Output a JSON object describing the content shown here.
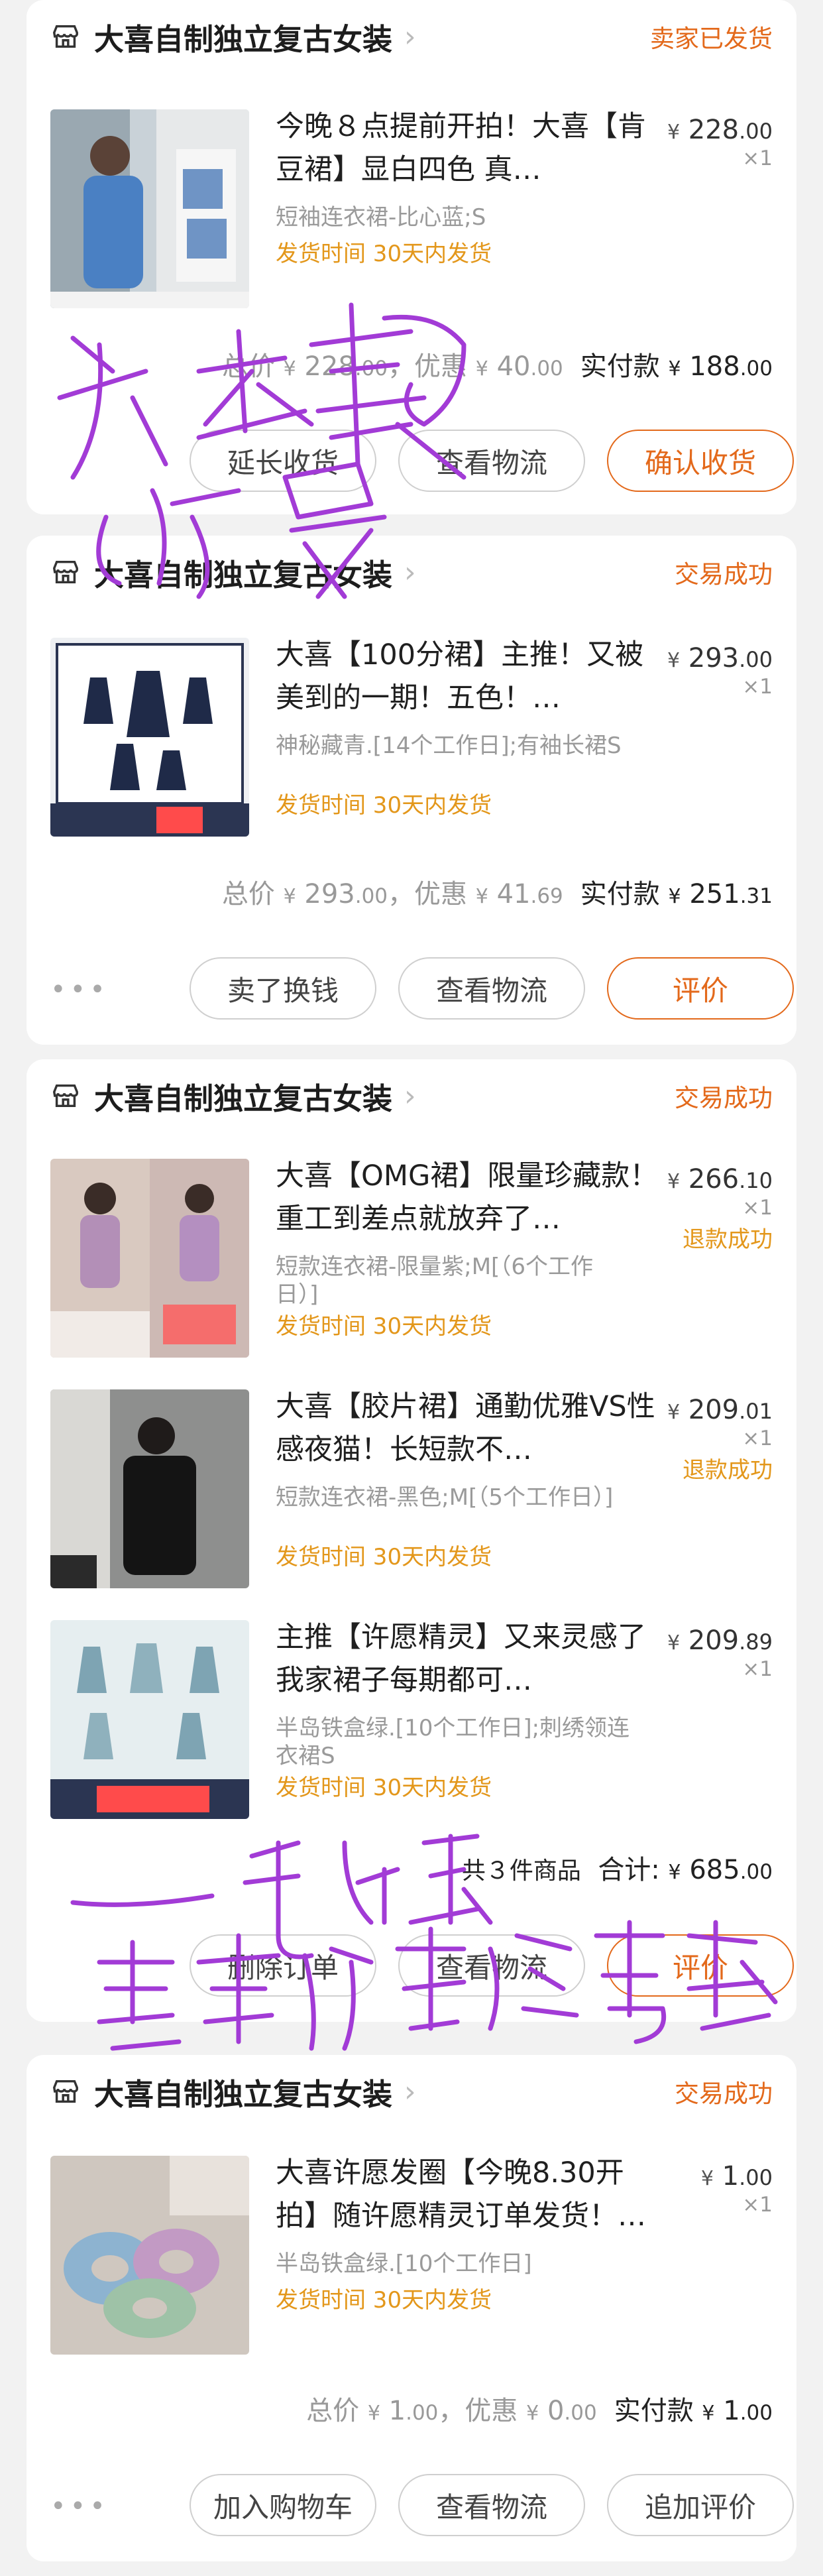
{
  "orders": [
    {
      "shop": "大喜自制独立复古女装",
      "status": "卖家已发货",
      "items": [
        {
          "title": "今晚８点提前开拍！大喜【肯豆裙】显白四色 真…",
          "sku": "短袖连衣裙-比心蓝;S",
          "ship": "发货时间  30天内发货",
          "price_cur": "¥",
          "price_int": "228",
          "price_dec": ".00",
          "qty": "×1",
          "refund": ""
        }
      ],
      "summary": {
        "prefix": "总价",
        "total_int": "228",
        "total_dec": ".00",
        "disc_label": "，优惠",
        "disc_int": "40",
        "disc_dec": ".00",
        "paid_label": "实付款",
        "paid_int": "188",
        "paid_dec": ".00"
      },
      "buttons": [
        {
          "label": "延长收货",
          "primary": false
        },
        {
          "label": "查看物流",
          "primary": false
        },
        {
          "label": "确认收货",
          "primary": true
        }
      ]
    },
    {
      "shop": "大喜自制独立复古女装",
      "status": "交易成功",
      "items": [
        {
          "title": "大喜【100分裙】主推！又被美到的一期！五色！…",
          "sku": "神秘藏青.[14个工作日];有袖长裙S",
          "ship": "发货时间  30天内发货",
          "price_cur": "¥",
          "price_int": "293",
          "price_dec": ".00",
          "qty": "×1",
          "refund": ""
        }
      ],
      "summary": {
        "prefix": "总价",
        "total_int": "293",
        "total_dec": ".00",
        "disc_label": "，优惠",
        "disc_int": "41",
        "disc_dec": ".69",
        "paid_label": "实付款",
        "paid_int": "251",
        "paid_dec": ".31"
      },
      "buttons": [
        {
          "label": "卖了换钱",
          "primary": false
        },
        {
          "label": "查看物流",
          "primary": false
        },
        {
          "label": "评价",
          "primary": true
        }
      ]
    },
    {
      "shop": "大喜自制独立复古女装",
      "status": "交易成功",
      "items": [
        {
          "title": "大喜【OMG裙】限量珍藏款！重工到差点就放弃了…",
          "sku": "短款连衣裙-限量紫;M[（6个工作日）]",
          "ship": "发货时间  30天内发货",
          "price_cur": "¥",
          "price_int": "266",
          "price_dec": ".10",
          "qty": "×1",
          "refund": "退款成功"
        },
        {
          "title": "大喜【胶片裙】通勤优雅VS性感夜猫！长短款不…",
          "sku": "短款连衣裙-黑色;M[（5个工作日）]",
          "ship": "发货时间  30天内发货",
          "price_cur": "¥",
          "price_int": "209",
          "price_dec": ".01",
          "qty": "×1",
          "refund": "退款成功"
        },
        {
          "title": "主推【许愿精灵】又来灵感了我家裙子每期都可…",
          "sku": "半岛铁盒绿.[10个工作日];刺绣领连衣裙S",
          "ship": "发货时间  30天内发货",
          "price_cur": "¥",
          "price_int": "209",
          "price_dec": ".89",
          "qty": "×1",
          "refund": ""
        }
      ],
      "summary": {
        "count": "共３件商品",
        "total_label": "合计:",
        "total_int": "685",
        "total_dec": ".00"
      },
      "buttons": [
        {
          "label": "删除订单",
          "primary": false
        },
        {
          "label": "查看物流",
          "primary": false
        },
        {
          "label": "评价",
          "primary": true
        }
      ]
    },
    {
      "shop": "大喜自制独立复古女装",
      "status": "交易成功",
      "items": [
        {
          "title": "大喜许愿发圈【今晚8.30开拍】随许愿精灵订单发货！…",
          "sku": "半岛铁盒绿.[10个工作日]",
          "ship": "发货时间  30天内发货",
          "price_cur": "¥",
          "price_int": "1",
          "price_dec": ".00",
          "qty": "×1",
          "refund": ""
        }
      ],
      "summary": {
        "prefix": "总价",
        "total_int": "1",
        "total_dec": ".00",
        "disc_label": "，优惠",
        "disc_int": "0",
        "disc_dec": ".00",
        "paid_label": "实付款",
        "paid_int": "1",
        "paid_dec": ".00"
      },
      "buttons": [
        {
          "label": "加入购物车",
          "primary": false
        },
        {
          "label": "查看物流",
          "primary": false
        },
        {
          "label": "追加评价",
          "primary": false
        }
      ]
    }
  ],
  "more_dots": "•••",
  "currency": "¥",
  "colors": {
    "accent": "#e3691b",
    "ship": "#e3971b",
    "scribble": "#a23bd6"
  }
}
